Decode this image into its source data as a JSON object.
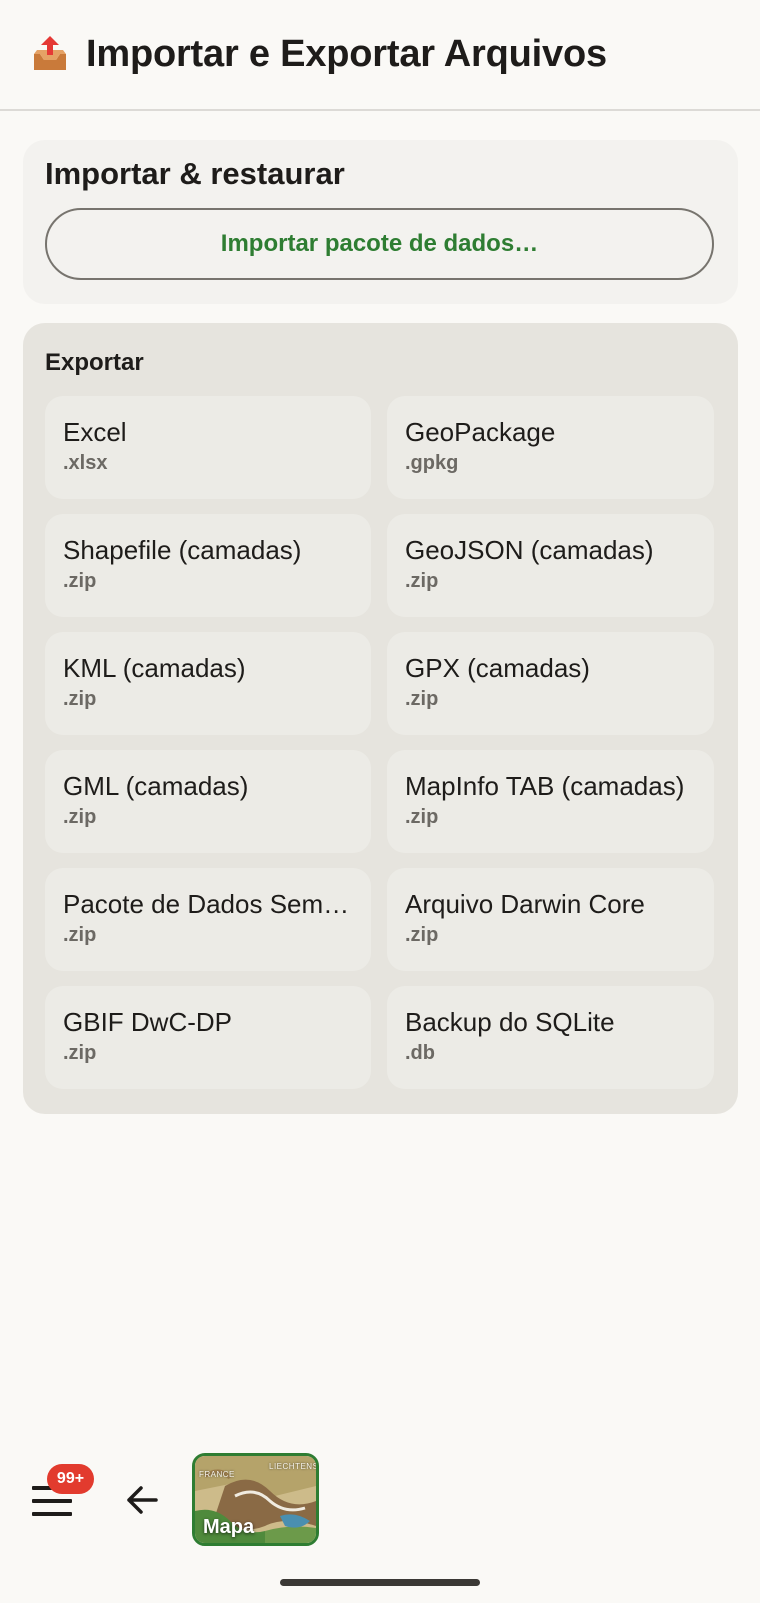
{
  "header": {
    "title": "Importar e Exportar Arquivos",
    "icon": "outbox-tray-icon"
  },
  "import_card": {
    "title": "Importar & restaurar",
    "button_label": "Importar pacote de dados…"
  },
  "export_card": {
    "title": "Exportar",
    "items": [
      {
        "name": "Excel",
        "ext": ".xlsx"
      },
      {
        "name": "GeoPackage",
        "ext": ".gpkg"
      },
      {
        "name": "Shapefile (camadas)",
        "ext": ".zip"
      },
      {
        "name": "GeoJSON (camadas)",
        "ext": ".zip"
      },
      {
        "name": "KML (camadas)",
        "ext": ".zip"
      },
      {
        "name": "GPX (camadas)",
        "ext": ".zip"
      },
      {
        "name": "GML (camadas)",
        "ext": ".zip"
      },
      {
        "name": "MapInfo TAB (camadas)",
        "ext": ".zip"
      },
      {
        "name": "Pacote de Dados Sem …",
        "ext": ".zip"
      },
      {
        "name": "Arquivo Darwin Core",
        "ext": ".zip"
      },
      {
        "name": "GBIF DwC-DP",
        "ext": ".zip"
      },
      {
        "name": "Backup do SQLite",
        "ext": ".db"
      }
    ]
  },
  "bottom_bar": {
    "badge": "99+",
    "map_label": "Mapa",
    "map_text_france": "FRANCE",
    "map_text_liechtenstein": "LIECHTENS"
  },
  "colors": {
    "accent_green": "#2e7d32",
    "badge_red": "#e23b2e",
    "background": "#faf9f6"
  }
}
